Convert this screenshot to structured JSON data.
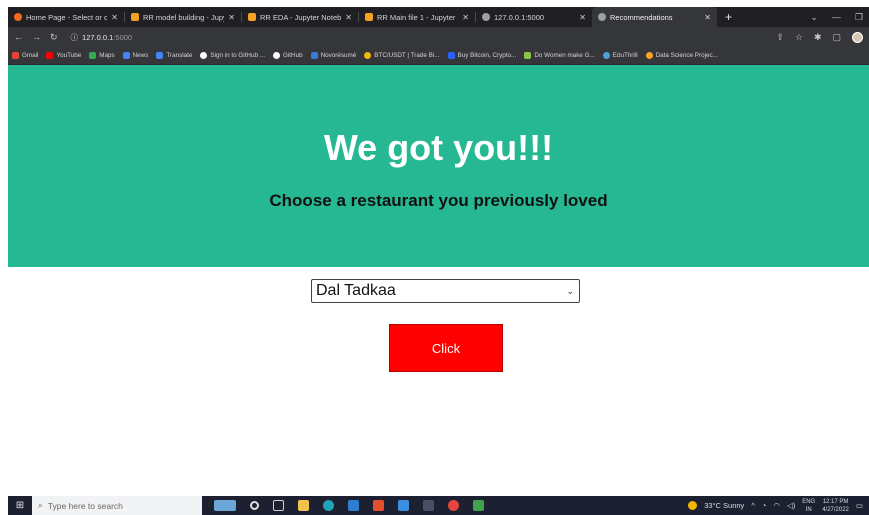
{
  "browser": {
    "tabs": [
      {
        "title": "Home Page - Select or crea",
        "favicon_color": "#f26b1d",
        "active": false
      },
      {
        "title": "RR model building - Jupyt",
        "favicon_color": "#f3a324",
        "active": false
      },
      {
        "title": "RR EDA - Jupyter Notebook",
        "favicon_color": "#f3a324",
        "active": false
      },
      {
        "title": "RR Main file 1 - Jupyter No",
        "favicon_color": "#f3a324",
        "active": false
      },
      {
        "title": "127.0.0.1:5000",
        "favicon_color": "#9aa0a6",
        "active": false
      },
      {
        "title": "Recommendations",
        "favicon_color": "#9aa0a6",
        "active": true
      }
    ],
    "new_tab_label": "+",
    "url_host": "127.0.0.1",
    "url_port": ":5000",
    "bookmarks": [
      {
        "label": "Gmail",
        "color": "#ea4335"
      },
      {
        "label": "YouTube",
        "color": "#ff0000"
      },
      {
        "label": "Maps",
        "color": "#34a853"
      },
      {
        "label": "News",
        "color": "#4285f4"
      },
      {
        "label": "Translate",
        "color": "#4285f4"
      },
      {
        "label": "Sign in to GitHub ...",
        "color": "#ffffff"
      },
      {
        "label": "GitHub",
        "color": "#ffffff"
      },
      {
        "label": "Novorésumé",
        "color": "#3a7bd5"
      },
      {
        "label": "BTC/USDT | Trade Bi...",
        "color": "#f0b90b"
      },
      {
        "label": "Buy Bitcoin, Crypto...",
        "color": "#2962ff"
      },
      {
        "label": "Do Women make G...",
        "color": "#8bc34a"
      },
      {
        "label": "EduThrill",
        "color": "#4aa3df"
      },
      {
        "label": "Data Science Projec...",
        "color": "#f5a623"
      }
    ]
  },
  "page": {
    "heading": "We got you!!!",
    "subheading": "Choose a restaurant you previously loved",
    "restaurant_select": {
      "selected": "Dal Tadkaa"
    },
    "submit_label": "Click",
    "colors": {
      "hero": "#25b892",
      "button": "#ff0000"
    }
  },
  "taskbar": {
    "search_placeholder": "Type here to search",
    "weather": "33°C  Sunny",
    "language": "ENG",
    "language_sub": "IN",
    "time": "12:17 PM",
    "date": "4/27/2022"
  }
}
